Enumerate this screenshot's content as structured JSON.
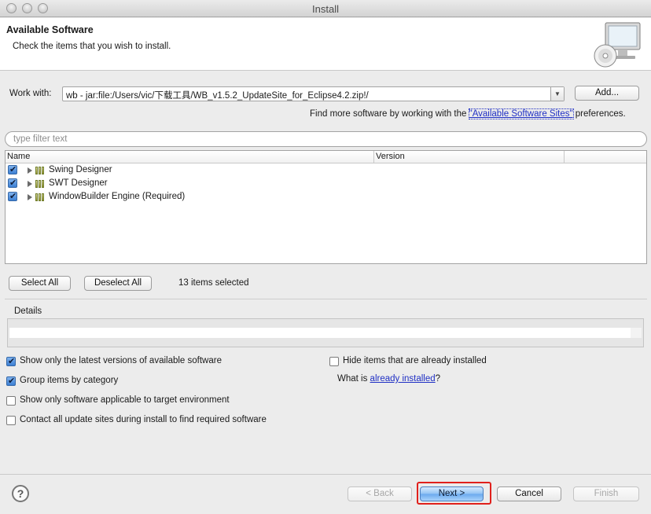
{
  "window": {
    "title": "Install"
  },
  "header": {
    "title": "Available Software",
    "subtitle": "Check the items that you wish to install.",
    "icon": "cd-monitor-icon"
  },
  "work_with": {
    "label": "Work with:",
    "value": "wb - jar:file:/Users/vic/下载工具/WB_v1.5.2_UpdateSite_for_Eclipse4.2.zip!/",
    "add_label": "Add...",
    "find_more_prefix": "Find more software by working with the ",
    "find_more_link": "\"Available Software Sites\"",
    "find_more_suffix": " preferences."
  },
  "filter": {
    "placeholder": "type filter text"
  },
  "table": {
    "columns": [
      "Name",
      "Version"
    ],
    "rows": [
      {
        "label": "Swing Designer",
        "checked": true
      },
      {
        "label": "SWT Designer",
        "checked": true
      },
      {
        "label": "WindowBuilder Engine (Required)",
        "checked": true
      }
    ]
  },
  "selection": {
    "select_all": "Select All",
    "deselect_all": "Deselect All",
    "count_text": "13 items selected"
  },
  "details": {
    "label": "Details"
  },
  "options": {
    "latest_only": {
      "label": "Show only the latest versions of available software",
      "checked": true
    },
    "group_by_category": {
      "label": "Group items by category",
      "checked": true
    },
    "target_env_only": {
      "label": "Show only software applicable to target environment",
      "checked": false
    },
    "contact_all_sites": {
      "label": "Contact all update sites during install to find required software",
      "checked": false
    },
    "hide_installed": {
      "label": "Hide items that are already installed",
      "checked": false
    },
    "what_is_prefix": "What is ",
    "what_is_link": "already installed",
    "what_is_suffix": "?"
  },
  "buttons": {
    "back": "< Back",
    "next": "Next >",
    "cancel": "Cancel",
    "finish": "Finish"
  },
  "colors": {
    "highlight_border": "#e0201c",
    "link": "#1f2fc4"
  }
}
